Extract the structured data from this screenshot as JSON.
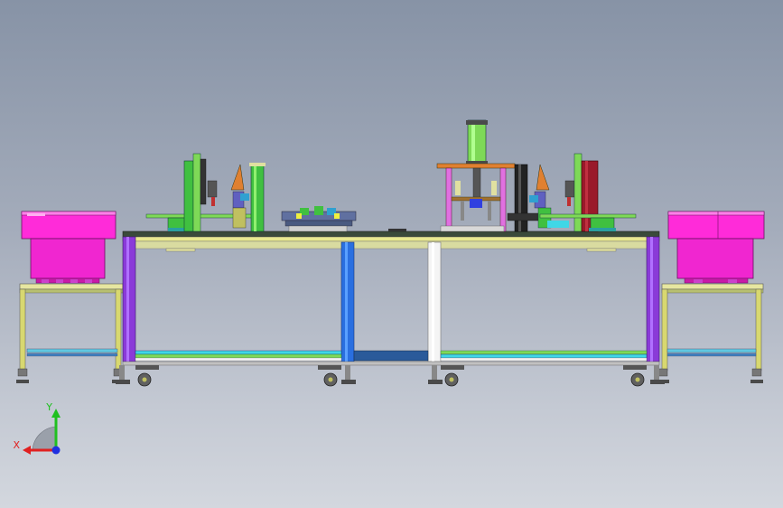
{
  "viewport": {
    "background_top": "#8793a6",
    "background_bottom": "#d3d7de"
  },
  "triad": {
    "x_label": "X",
    "y_label": "Y",
    "x_color": "#e02020",
    "y_color": "#20c020",
    "z_color": "#2030e0"
  },
  "colors": {
    "feeder_bowl": "#ff2bd9",
    "feeder_bowl_dark": "#c81aa8",
    "frame_green": "#7ed957",
    "frame_blue": "#2a6fe0",
    "frame_purple": "#8a3ad8",
    "frame_cyan": "#3fd7e6",
    "frame_white": "#f4f4f4",
    "table_top": "#e8e890",
    "press_orange": "#e08030",
    "press_pink": "#e070e0",
    "station_red": "#c03030",
    "station_green": "#40c040"
  }
}
